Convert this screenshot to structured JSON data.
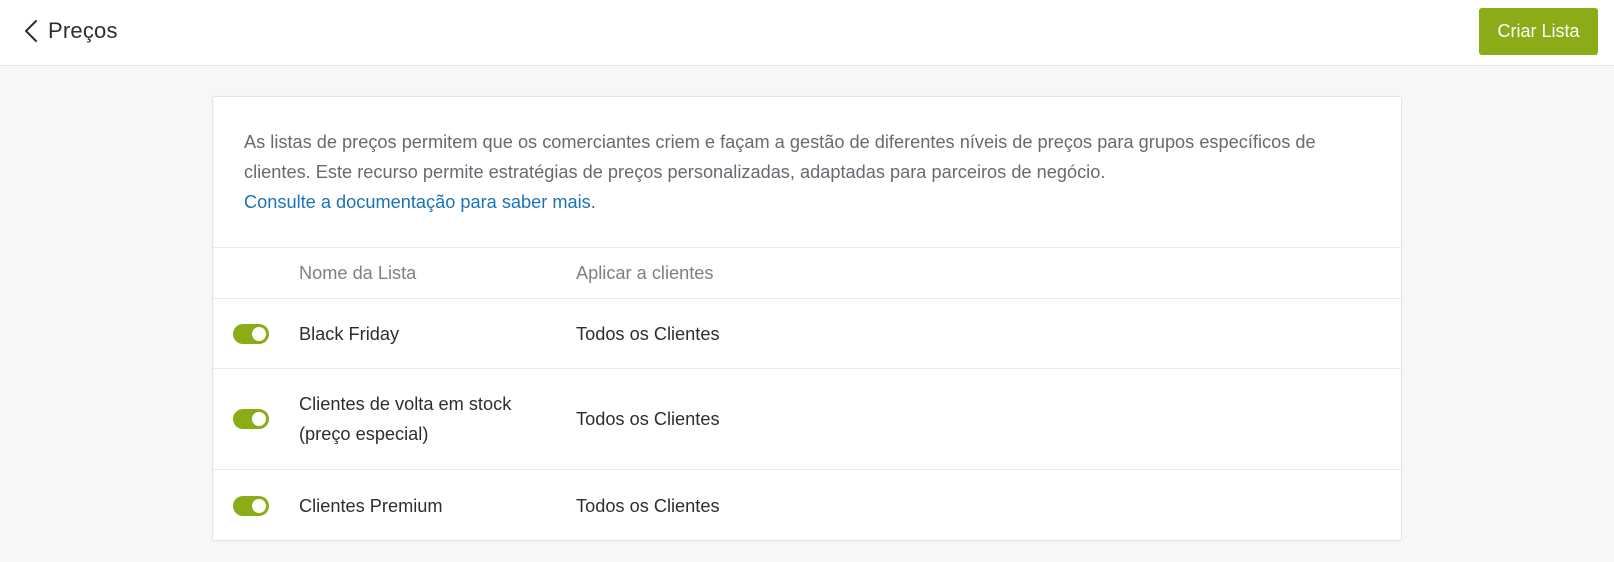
{
  "header": {
    "back_icon": "chevron-left-icon",
    "title": "Preços",
    "create_button": "Criar Lista"
  },
  "intro": {
    "text": "As listas de preços permitem que os comerciantes criem e façam a gestão de diferentes níveis de preços para grupos específicos de clientes. Este recurso permite estratégias de preços personalizadas, adaptadas para parceiros de negócio.",
    "link": "Consulte a documentação para saber mais."
  },
  "table": {
    "columns": [
      "Nome da Lista",
      "Aplicar a clientes"
    ],
    "rows": [
      {
        "enabled": true,
        "name": "Black Friday",
        "apply_to": "Todos os Clientes"
      },
      {
        "enabled": true,
        "name": "Clientes de volta em stock (preço especial)",
        "apply_to": "Todos os Clientes"
      },
      {
        "enabled": true,
        "name": "Clientes Premium",
        "apply_to": "Todos os Clientes"
      }
    ]
  },
  "colors": {
    "accent": "#8aac16",
    "link": "#1a73b8",
    "background": "#f6f7f9"
  }
}
